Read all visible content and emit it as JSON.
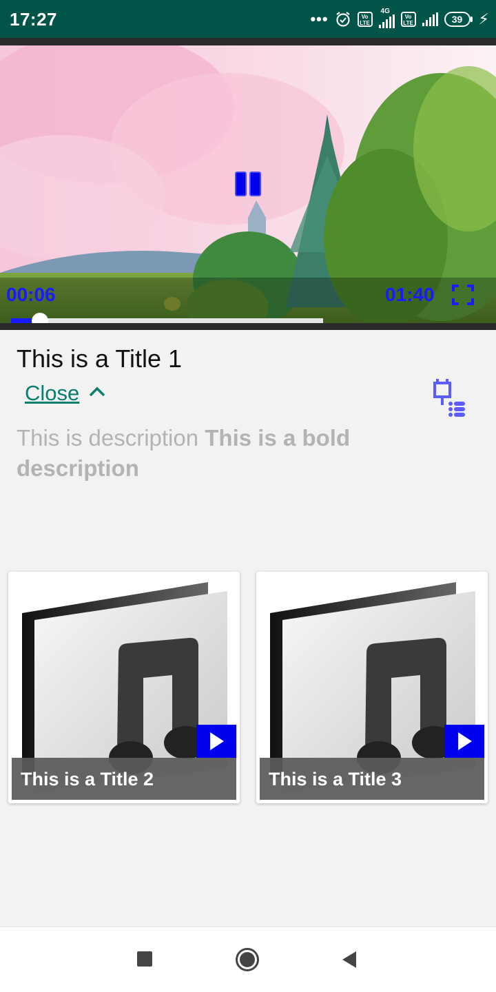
{
  "status_bar": {
    "time": "17:27",
    "dots": "•••",
    "network": "4G",
    "sim1_badge": "Vo LTE",
    "sim2_badge": "Vo LTE",
    "battery": "39",
    "icons": [
      "more-dots-icon",
      "alarm-icon",
      "volte-icon",
      "signal-icon",
      "volte-icon",
      "signal-icon",
      "battery-icon",
      "charging-icon"
    ]
  },
  "player": {
    "current_time": "00:06",
    "total_time": "01:40",
    "progress_fraction": 0.06,
    "buffered_fraction": 0.64,
    "state": "playing",
    "accent_color": "#1a1aff"
  },
  "detail": {
    "title": "This is a Title 1",
    "close_label": "Close",
    "description_normal": "This is description ",
    "description_bold": "This is a bold description"
  },
  "related": [
    {
      "title": "This is a Title 2"
    },
    {
      "title": "This is a Title 3"
    }
  ],
  "colors": {
    "status_bar": "#005548",
    "link": "#0a7d6e",
    "play_badge": "#0000ee",
    "playlist_icon": "#5b5bff"
  }
}
